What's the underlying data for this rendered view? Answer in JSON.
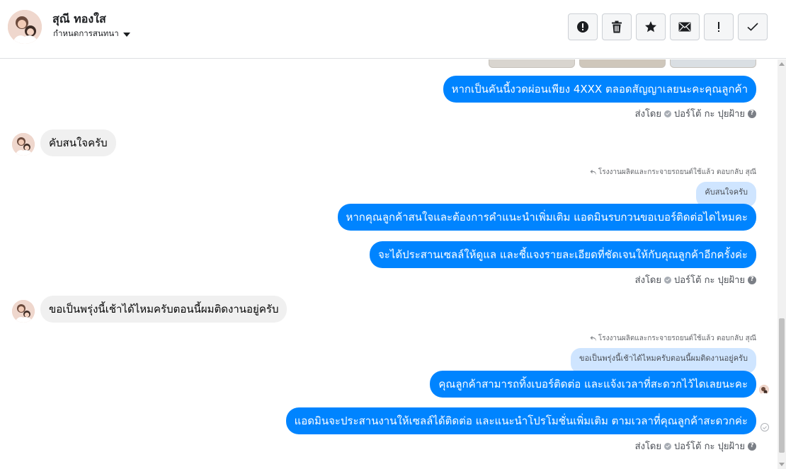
{
  "header": {
    "contact_name": "สุณี ทองใส",
    "label_dropdown": "กำหนดการสนทนา",
    "toolbar": [
      {
        "icon": "alert-circle-icon"
      },
      {
        "icon": "trash-icon"
      },
      {
        "icon": "star-icon"
      },
      {
        "icon": "envelope-icon"
      },
      {
        "icon": "exclamation-icon"
      },
      {
        "icon": "checkmark-icon"
      }
    ]
  },
  "thread": {
    "messages": [
      {
        "text": "หากเป็นคันนี้งวดผ่อนเพียง 4XXX ตลอดสัญญาเลยนะคะคุณลูกค้า"
      },
      {
        "text": "คับสนใจครับ"
      },
      {
        "text": "หากคุณลูกค้าสนใจและต้องการคำแนะนำเพิ่มเติม แอดมินรบกวนขอเบอร์ติดต่อไดไหมคะ"
      },
      {
        "text": "จะได้ประสานเซลล์ให้ดูแล และชี้แจงรายละเอียดที่ชัดเจนให้กับคุณลูกค้าอีกครั้งค่ะ"
      },
      {
        "text": "ขอเป็นพรุ่งนี้เช้าได้ไหมครับตอนนี้ผมติดงานอยู่ครับ"
      },
      {
        "text": "คุณลูกค้าสามารถทิ้งเบอร์ติดต่อ และแจ้งเวลาที่สะดวกไว้ไดเลยนะคะ"
      },
      {
        "text": "แอดมินจะประสานงานให้เซลล์ได้ติดต่อ และแนะนำโปรโมชั่นเพิ่มเติม ตามเวลาที่คุณลูกค้าสะดวกค่ะ"
      }
    ],
    "sent_by": {
      "prefix": "ส่งโดย",
      "name": "ปอร์โต้ กะ ปุยฝ้าย"
    },
    "replies": [
      {
        "note": "โรงงานผลิตและกระจายรถยนต์ใช้แล้ว ตอบกลับ สุณี",
        "quote": "คับสนใจครับ"
      },
      {
        "note": "โรงงานผลิตและกระจายรถยนต์ใช้แล้ว ตอบกลับ สุณี",
        "quote": "ขอเป็นพรุ่งนี้เช้าได้ไหมครับตอนนี้ผมติดงานอยู่ครับ"
      }
    ]
  },
  "colors": {
    "outgoing_bubble": "#0084ff",
    "incoming_bubble": "#f0f0f0",
    "quote_bubble": "#cfe5ff"
  }
}
